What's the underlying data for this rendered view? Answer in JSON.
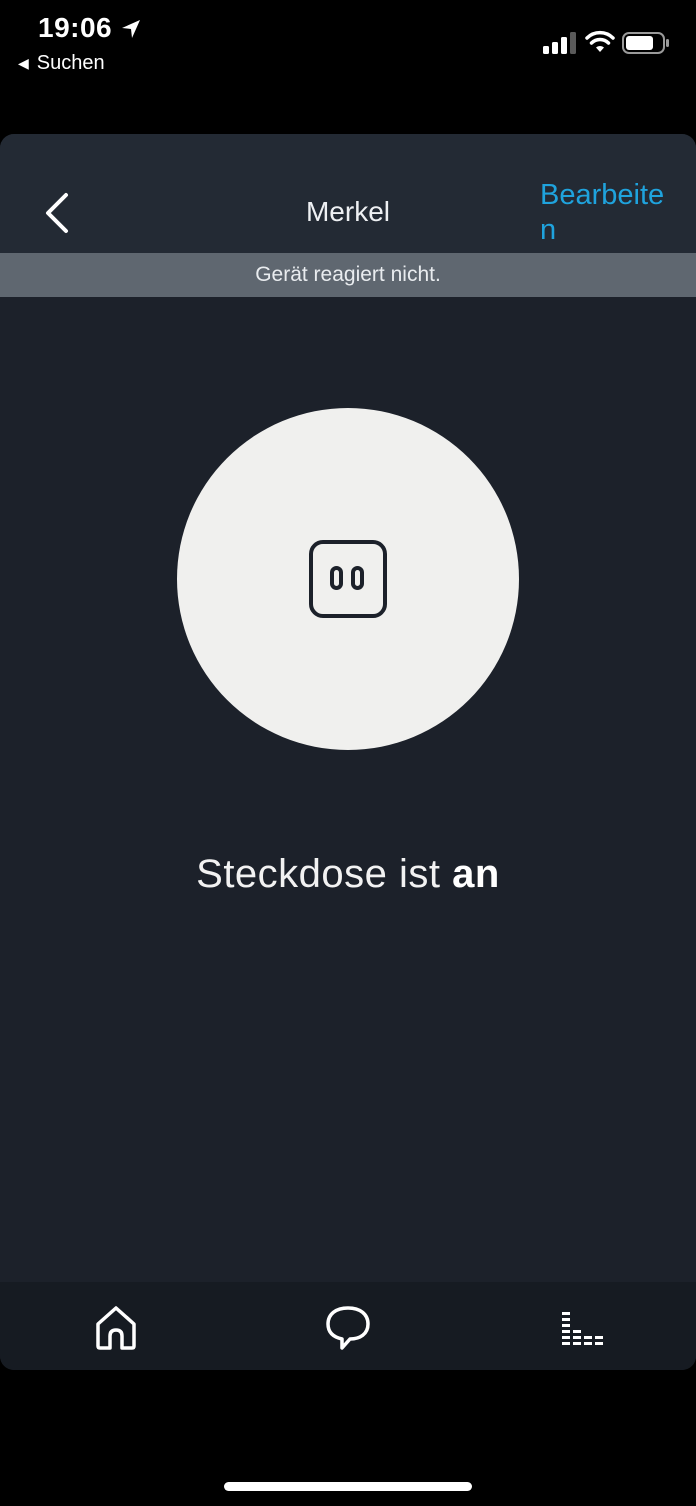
{
  "status_bar": {
    "time": "19:06",
    "back_app_label": "Suchen",
    "icons": [
      "location-arrow-icon",
      "signal-icon",
      "wifi-icon",
      "battery-icon"
    ]
  },
  "nav": {
    "title": "Merkel",
    "edit_label": "Bearbeiten",
    "back_icon": "chevron-left-icon"
  },
  "banner": {
    "text": "Gerät reagiert nicht."
  },
  "device": {
    "icon": "power-outlet-icon",
    "state_prefix": "Steckdose ist ",
    "state_value": "an"
  },
  "tabbar": {
    "items": [
      {
        "name": "home",
        "icon": "home-icon"
      },
      {
        "name": "communicate",
        "icon": "chat-bubble-icon"
      },
      {
        "name": "play",
        "icon": "equalizer-icon"
      }
    ]
  },
  "colors": {
    "background": "#1c212a",
    "nav_background": "#232a34",
    "accent": "#1fa3dd",
    "banner": "#5f6770",
    "circle": "#f0f0ee"
  }
}
